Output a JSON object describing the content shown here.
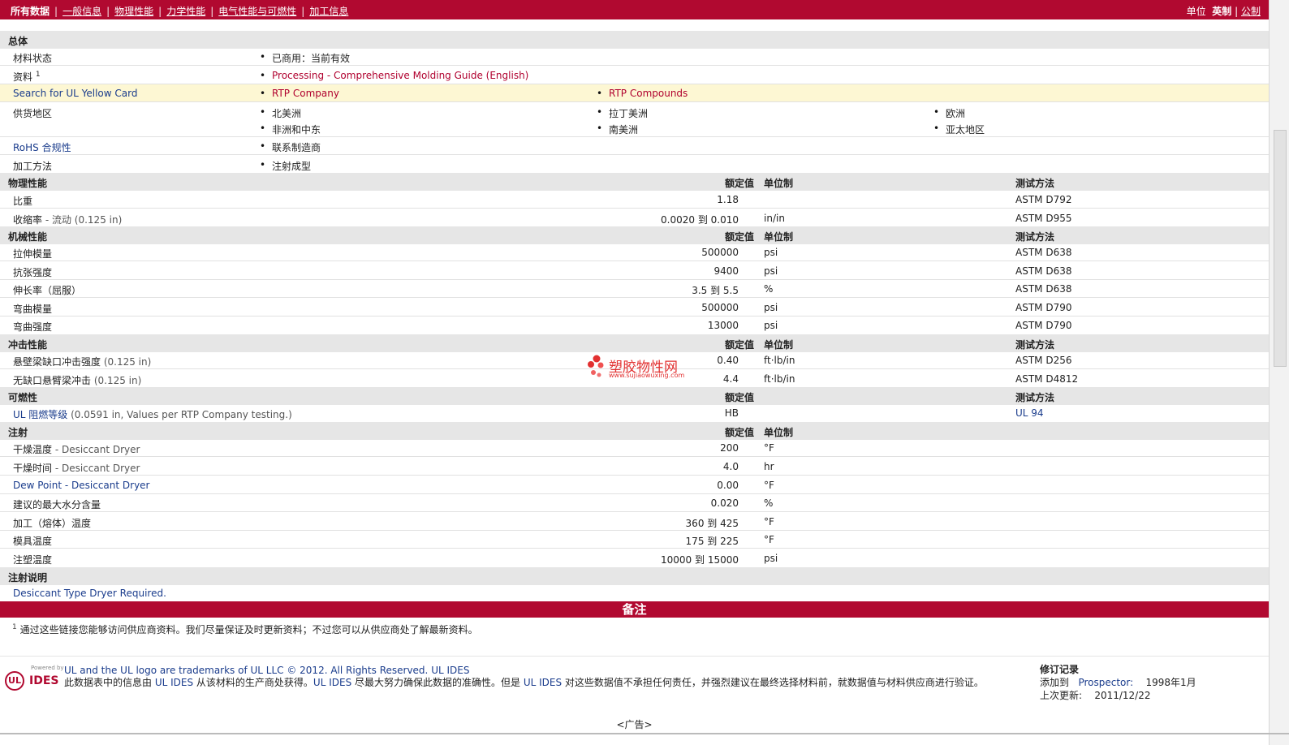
{
  "topbar": {
    "nav": [
      {
        "label": "所有数据",
        "active": true
      },
      {
        "label": "一般信息"
      },
      {
        "label": "物理性能"
      },
      {
        "label": "力学性能"
      },
      {
        "label": "电气性能与可燃性"
      },
      {
        "label": "加工信息"
      }
    ],
    "units_label": "单位",
    "units_imperial": "英制",
    "units_sep": "|",
    "units_metric": "公制"
  },
  "general": {
    "title": "总体",
    "rows": [
      {
        "label": "材料状态",
        "items": [
          "已商用：当前有效"
        ]
      },
      {
        "label": "资料",
        "sup": "1",
        "items": [
          "Processing - Comprehensive Molding Guide (English)"
        ]
      },
      {
        "label": "Search for UL Yellow Card",
        "items": [
          "RTP Company",
          "RTP Compounds"
        ]
      },
      {
        "label": "供货地区",
        "items": [
          "北美洲",
          "拉丁美洲",
          "欧洲",
          "非洲和中东",
          "南美洲",
          "亚太地区"
        ]
      },
      {
        "label": "RoHS 合规性",
        "items": [
          "联系制造商"
        ]
      },
      {
        "label": "加工方法",
        "items": [
          "注射成型"
        ]
      }
    ]
  },
  "headers": {
    "nominal": "额定值",
    "unit": "单位制",
    "method": "测试方法"
  },
  "physical": {
    "title": "物理性能",
    "rows": [
      {
        "label": "比重",
        "cond": "",
        "value": "1.18",
        "unit": "",
        "method": "ASTM D792"
      },
      {
        "label": "收缩率",
        "cond": " - 流动  (0.125 in)",
        "value": "0.0020 到  0.010",
        "unit": "in/in",
        "method": "ASTM D955"
      }
    ]
  },
  "mechanical": {
    "title": "机械性能",
    "rows": [
      {
        "label": "拉伸模量",
        "cond": "",
        "value": "500000",
        "unit": "psi",
        "method": "ASTM D638"
      },
      {
        "label": "抗张强度",
        "cond": "",
        "value": "9400",
        "unit": "psi",
        "method": "ASTM D638"
      },
      {
        "label": "伸长率（屈服）",
        "cond": "",
        "value": "3.5 到  5.5",
        "unit": "%",
        "method": "ASTM D638"
      },
      {
        "label": "弯曲模量",
        "cond": "",
        "value": "500000",
        "unit": "psi",
        "method": "ASTM D790"
      },
      {
        "label": "弯曲强度",
        "cond": "",
        "value": "13000",
        "unit": "psi",
        "method": "ASTM D790"
      }
    ]
  },
  "impact": {
    "title": "冲击性能",
    "rows": [
      {
        "label": "悬壁梁缺口冲击强度",
        "cond": "  (0.125 in)",
        "value": "0.40",
        "unit": "ft·lb/in",
        "method": "ASTM D256"
      },
      {
        "label": "无缺口悬臂梁冲击",
        "cond": "  (0.125 in)",
        "value": "4.4",
        "unit": "ft·lb/in",
        "method": "ASTM D4812"
      }
    ]
  },
  "flammability": {
    "title": "可燃性",
    "rows": [
      {
        "label": "UL 阻燃等级",
        "cond": "  (0.0591 in, Values per RTP Company testing.)",
        "value": "HB",
        "unit": "",
        "method": "UL 94"
      }
    ]
  },
  "injection": {
    "title": "注射",
    "rows": [
      {
        "label": "干燥温度",
        "cond": " - Desiccant Dryer",
        "value": "200",
        "unit": "°F"
      },
      {
        "label": "干燥时间",
        "cond": " - Desiccant Dryer",
        "value": "4.0",
        "unit": "hr"
      },
      {
        "label": "Dew Point - Desiccant Dryer",
        "cond": "",
        "value": "0.00",
        "unit": "°F"
      },
      {
        "label": "建议的最大水分含量",
        "cond": "",
        "value": "0.020",
        "unit": "%"
      },
      {
        "label": "加工（熔体）温度",
        "cond": "",
        "value": "360 到  425",
        "unit": "°F"
      },
      {
        "label": "模具温度",
        "cond": "",
        "value": "175 到  225",
        "unit": "°F"
      },
      {
        "label": "注塑温度",
        "cond": "",
        "value": "10000 到  15000",
        "unit": "psi"
      }
    ]
  },
  "inj_notes": {
    "title": "注射说明",
    "text": "Desiccant Type Dryer Required."
  },
  "notes": {
    "title": "备注",
    "sup": "1",
    "text": "通过这些链接您能够访问供应商资料。我们尽量保证及时更新资料；不过您可以从供应商处了解最新资料。"
  },
  "footer": {
    "logo_powered": "Powered by",
    "logo_ul": "UL",
    "logo_ides": "IDES",
    "trademark": "UL and the UL logo are trademarks of UL LLC © 2012. All Rights Reserved.",
    "ul_ides_link": "UL IDES",
    "disclaimer_a": "此数据表中的信息由 ",
    "disclaimer_b": " 从该材料的生产商处获得。",
    "disclaimer_c": " 尽最大努力确保此数据的准确性。但是 ",
    "disclaimer_d": " 对这些数据值不承担任何责任，并强烈建议在最终选择材料前，就数据值与材料供应商进行验证。",
    "rev_title": "修订记录",
    "added_label": "添加到",
    "prospector": "Prospector:",
    "added_date": "1998年1月",
    "updated_label": "上次更新:",
    "updated_date": "2011/12/22"
  },
  "ad": "<广告>",
  "watermark": {
    "cn": "塑胶物性网",
    "url": "www.sujiaowuxing.com"
  },
  "colors": {
    "brand_red": "#b10930",
    "section_gray": "#e6e6e6",
    "highlight_yellow": "#fdf7d3",
    "link": "#b0002e"
  }
}
